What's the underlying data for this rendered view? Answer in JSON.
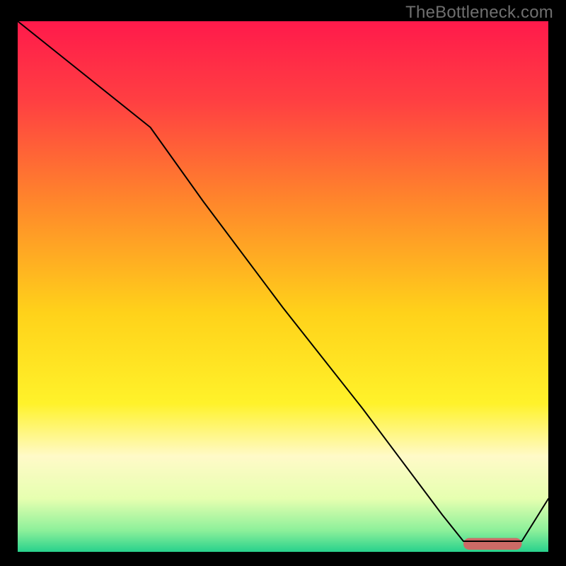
{
  "watermark": "TheBottleneck.com",
  "chart_data": {
    "type": "line",
    "title": "",
    "xlabel": "",
    "ylabel": "",
    "xlim": [
      0,
      100
    ],
    "ylim": [
      0,
      100
    ],
    "grid": false,
    "background_gradient": {
      "stops": [
        {
          "pos": 0.0,
          "color": "#ff1a4b"
        },
        {
          "pos": 0.15,
          "color": "#ff3f42"
        },
        {
          "pos": 0.35,
          "color": "#ff8a2a"
        },
        {
          "pos": 0.55,
          "color": "#ffd21a"
        },
        {
          "pos": 0.72,
          "color": "#fff22a"
        },
        {
          "pos": 0.82,
          "color": "#fffac8"
        },
        {
          "pos": 0.9,
          "color": "#e6ffb0"
        },
        {
          "pos": 0.96,
          "color": "#8cf09a"
        },
        {
          "pos": 1.0,
          "color": "#28d18c"
        }
      ]
    },
    "series": [
      {
        "name": "bottleneck-curve",
        "stroke": "#000000",
        "stroke_width": 2,
        "x": [
          0,
          10,
          25,
          35,
          50,
          65,
          80,
          84,
          90,
          95,
          100
        ],
        "y": [
          100,
          92,
          80,
          66,
          46,
          27,
          7,
          2,
          2,
          2,
          10
        ]
      }
    ],
    "markers": [
      {
        "name": "optimal-segment",
        "shape": "rounded-bar",
        "color": "#cc6a66",
        "x_start": 84,
        "x_end": 95,
        "y": 1.5,
        "height_pct": 2.2
      }
    ]
  }
}
